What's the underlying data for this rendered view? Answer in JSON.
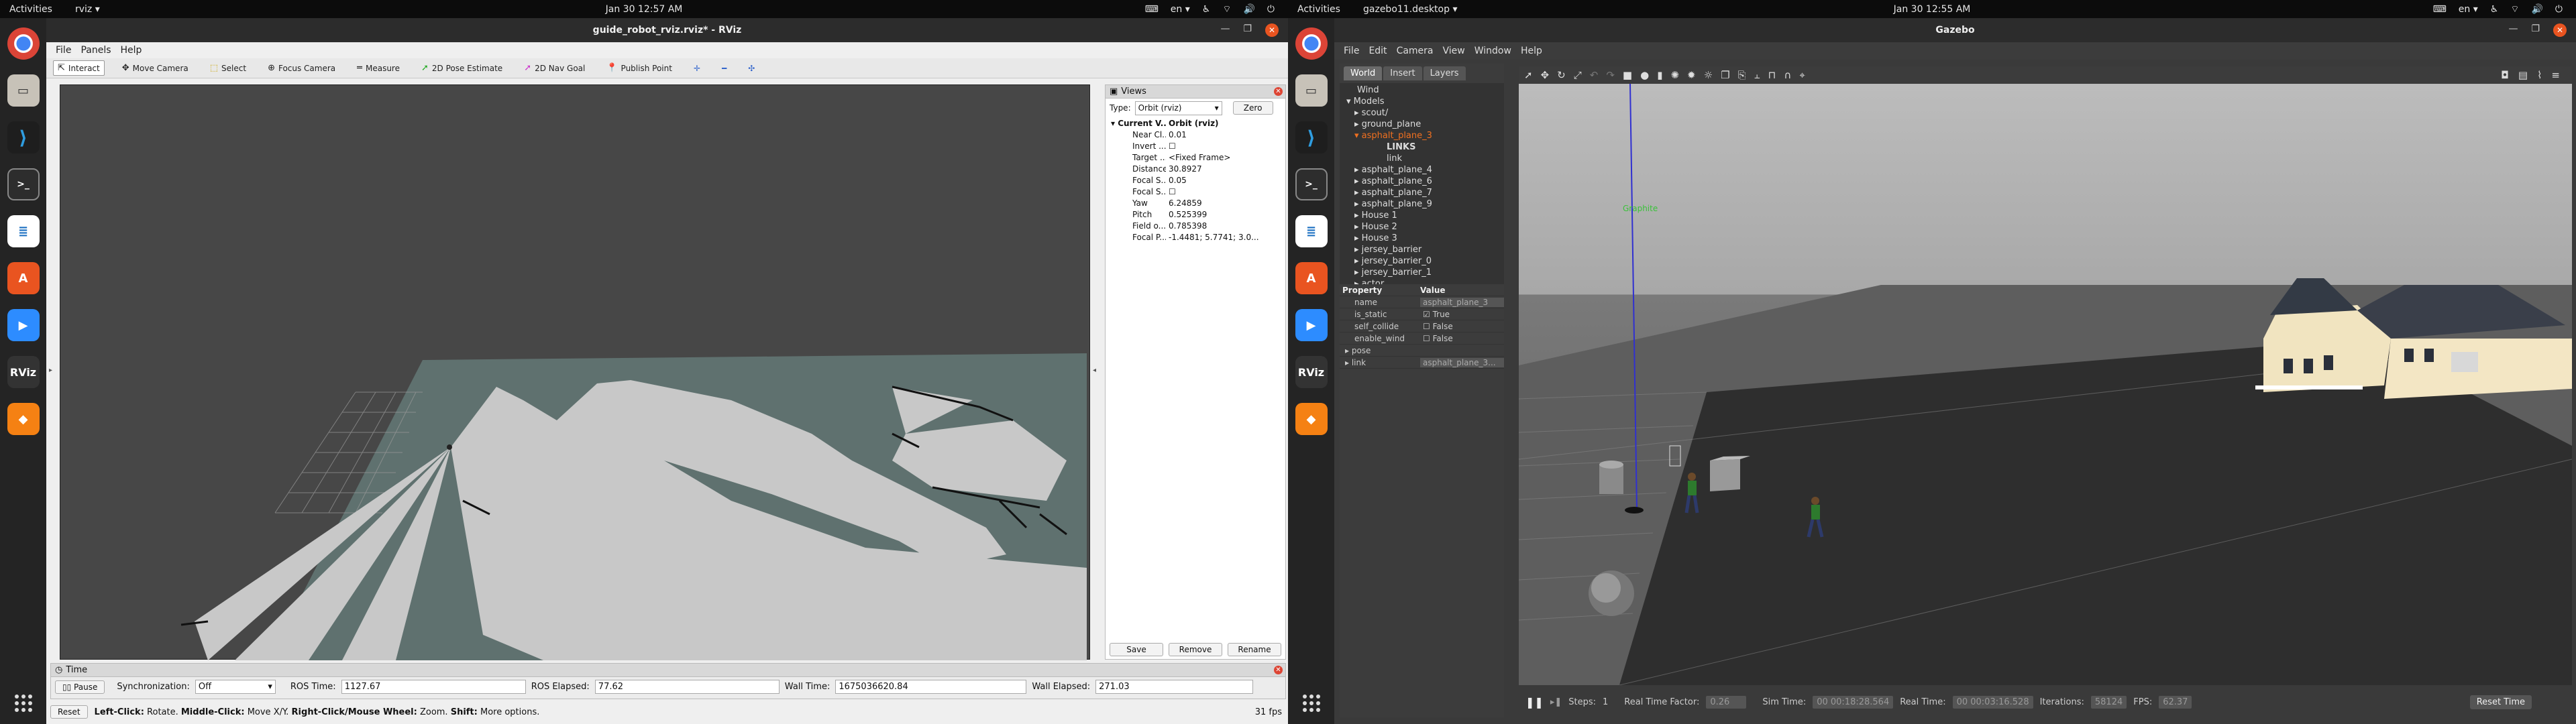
{
  "left_top": {
    "activities": "Activities",
    "app": "rviz ▾",
    "clock": "Jan 30  12:57 AM",
    "lang": "en ▾"
  },
  "right_top": {
    "activities": "Activities",
    "app": "gazebo11.desktop ▾",
    "clock": "Jan 30  12:55 AM",
    "lang": "en ▾"
  },
  "rviz": {
    "title": "guide_robot_rviz.rviz* - RViz",
    "menu": [
      "File",
      "Panels",
      "Help"
    ],
    "tools": [
      {
        "icon": "⇱",
        "label": "Interact"
      },
      {
        "icon": "✥",
        "label": "Move Camera"
      },
      {
        "icon": "⬚",
        "label": "Select"
      },
      {
        "icon": "⊕",
        "label": "Focus Camera"
      },
      {
        "icon": "═",
        "label": "Measure"
      },
      {
        "icon": "➚",
        "label": "2D Pose Estimate"
      },
      {
        "icon": "➚",
        "label": "2D Nav Goal"
      },
      {
        "icon": "📍",
        "label": "Publish Point"
      }
    ],
    "views": {
      "title": "Views",
      "type_label": "Type:",
      "type_value": "Orbit (rviz)",
      "zero": "Zero",
      "current_key": "Current V...",
      "current_val": "Orbit (rviz)",
      "props": [
        {
          "k": "Near Cl...",
          "v": "0.01"
        },
        {
          "k": "Invert ...",
          "v": "☐"
        },
        {
          "k": "Target ...",
          "v": "<Fixed Frame>"
        },
        {
          "k": "Distance",
          "v": "30.8927"
        },
        {
          "k": "Focal S...",
          "v": "0.05"
        },
        {
          "k": "Focal S...",
          "v": "☐"
        },
        {
          "k": "Yaw",
          "v": "6.24859"
        },
        {
          "k": "Pitch",
          "v": "0.525399"
        },
        {
          "k": "Field o...",
          "v": "0.785398"
        },
        {
          "k": "Focal P...",
          "v": "-1.4481; 5.7741; 3.0..."
        }
      ],
      "save": "Save",
      "remove": "Remove",
      "rename": "Rename"
    },
    "time": {
      "title": "Time",
      "pause": "Pause",
      "sync_label": "Synchronization:",
      "sync_value": "Off",
      "ros_time_label": "ROS Time:",
      "ros_time": "1127.67",
      "ros_elapsed_label": "ROS Elapsed:",
      "ros_elapsed": "77.62",
      "wall_time_label": "Wall Time:",
      "wall_time": "1675036620.84",
      "wall_elapsed_label": "Wall Elapsed:",
      "wall_elapsed": "271.03"
    },
    "status": {
      "reset": "Reset",
      "hint_b1": "Left-Click:",
      "hint_t1": " Rotate. ",
      "hint_b2": "Middle-Click:",
      "hint_t2": " Move X/Y. ",
      "hint_b3": "Right-Click/Mouse Wheel:",
      "hint_t3": " Zoom. ",
      "hint_b4": "Shift:",
      "hint_t4": " More options.",
      "fps": "31 fps"
    }
  },
  "gazebo": {
    "title": "Gazebo",
    "menu": [
      "File",
      "Edit",
      "Camera",
      "View",
      "Window",
      "Help"
    ],
    "tabs": [
      "World",
      "Insert",
      "Layers"
    ],
    "tree": [
      "Wind",
      "▾ Models",
      "▸ scout/",
      "▸ ground_plane",
      "▾ asphalt_plane_3",
      "LINKS",
      "link",
      "▸ asphalt_plane_4",
      "▸ asphalt_plane_6",
      "▸ asphalt_plane_7",
      "▸ asphalt_plane_9",
      "▸ House 1",
      "▸ House 2",
      "▸ House 3",
      "▸ jersey_barrier",
      "▸ jersey_barrier_0",
      "▸ jersey_barrier_1",
      "▸ actor"
    ],
    "prop_header": {
      "k": "Property",
      "v": "Value"
    },
    "props": [
      {
        "k": "name",
        "v": "asphalt_plane_3"
      },
      {
        "k": "is_static",
        "v": "True"
      },
      {
        "k": "self_collide",
        "v": "False"
      },
      {
        "k": "enable_wind",
        "v": "False"
      },
      {
        "k": "▸ pose",
        "v": ""
      },
      {
        "k": "▸ link",
        "v": "asphalt_plane_3..."
      }
    ],
    "bottom": {
      "steps_label": "Steps:",
      "steps": "1",
      "rtf_label": "Real Time Factor:",
      "rtf": "0.26",
      "sim_label": "Sim Time:",
      "sim": "00 00:18:28.564",
      "real_label": "Real Time:",
      "real": "00 00:03:16.528",
      "iter_label": "Iterations:",
      "iter": "58124",
      "fps_label": "FPS:",
      "fps": "62.37",
      "reset": "Reset Time"
    },
    "label_green": "Graphite"
  },
  "accent": "#e95420"
}
